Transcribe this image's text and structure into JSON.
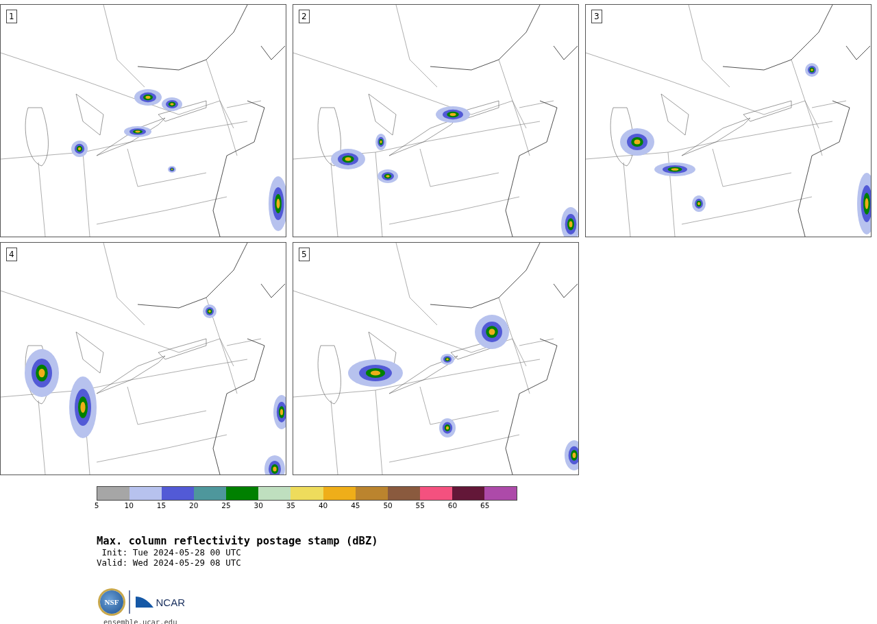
{
  "panels": [
    {
      "label": "1"
    },
    {
      "label": "2"
    },
    {
      "label": "3"
    },
    {
      "label": "4"
    },
    {
      "label": "5"
    }
  ],
  "colorbar": {
    "segments": [
      {
        "color": "#a6a6a6"
      },
      {
        "color": "#b7c2ee"
      },
      {
        "color": "#525ad6"
      },
      {
        "color": "#4e979c"
      },
      {
        "color": "#008000"
      },
      {
        "color": "#bfdfbf"
      },
      {
        "color": "#eedc5c"
      },
      {
        "color": "#efae19"
      },
      {
        "color": "#bb842e"
      },
      {
        "color": "#8a5a3e"
      },
      {
        "color": "#f4517f"
      },
      {
        "color": "#631738"
      },
      {
        "color": "#ad4aa9"
      }
    ],
    "ticks": [
      "5",
      "10",
      "15",
      "20",
      "25",
      "30",
      "35",
      "40",
      "45",
      "50",
      "55",
      "60",
      "65"
    ]
  },
  "title": "Max. column reflectivity postage stamp (dBZ)",
  "init": " Init: Tue 2024-05-28 00 UTC",
  "valid": "Valid: Wed 2024-05-29 08 UTC",
  "logos": {
    "nsf_text": "NSF",
    "ncar_text": "NCAR"
  },
  "url": "ensemble.ucar.edu"
}
